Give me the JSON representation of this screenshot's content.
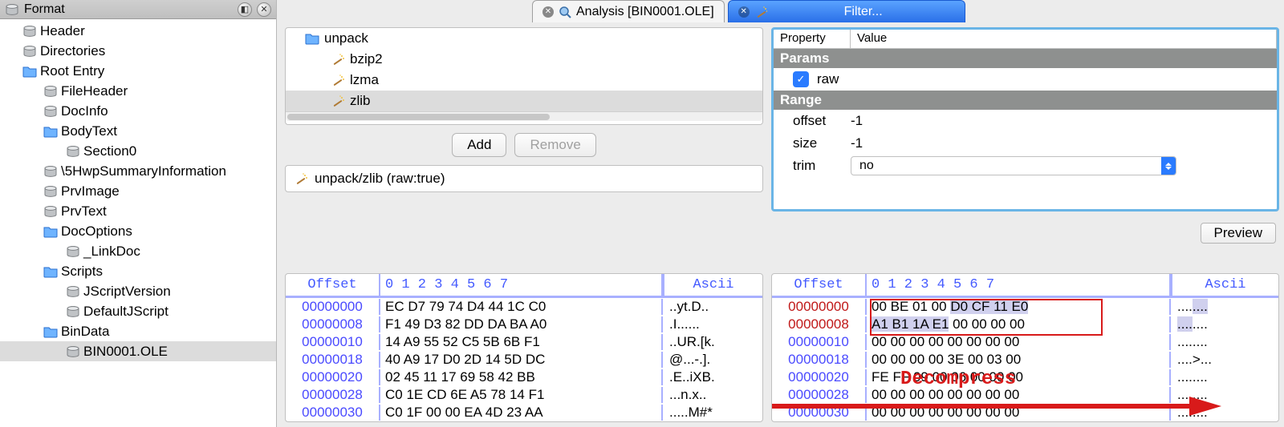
{
  "sidebar": {
    "title": "Format",
    "items": [
      {
        "label": "Header",
        "icon": "db",
        "indent": 0
      },
      {
        "label": "Directories",
        "icon": "db",
        "indent": 0
      },
      {
        "label": "Root Entry",
        "icon": "folder",
        "indent": 0
      },
      {
        "label": "FileHeader",
        "icon": "db",
        "indent": 1
      },
      {
        "label": "DocInfo",
        "icon": "db",
        "indent": 1
      },
      {
        "label": "BodyText",
        "icon": "folder",
        "indent": 1
      },
      {
        "label": "Section0",
        "icon": "db",
        "indent": 2
      },
      {
        "label": "\\5HwpSummaryInformation",
        "icon": "db",
        "indent": 1
      },
      {
        "label": "PrvImage",
        "icon": "db",
        "indent": 1
      },
      {
        "label": "PrvText",
        "icon": "db",
        "indent": 1
      },
      {
        "label": "DocOptions",
        "icon": "folder",
        "indent": 1
      },
      {
        "label": "_LinkDoc",
        "icon": "db",
        "indent": 2
      },
      {
        "label": "Scripts",
        "icon": "folder",
        "indent": 1
      },
      {
        "label": "JScriptVersion",
        "icon": "db",
        "indent": 2
      },
      {
        "label": "DefaultJScript",
        "icon": "db",
        "indent": 2
      },
      {
        "label": "BinData",
        "icon": "folder",
        "indent": 1
      },
      {
        "label": "BIN0001.OLE",
        "icon": "db",
        "indent": 2,
        "sel": true
      }
    ]
  },
  "tabs": {
    "analysis": "Analysis [BIN0001.OLE]",
    "filter": "Filter..."
  },
  "unpack": {
    "root": "unpack",
    "items": [
      "bzip2",
      "lzma",
      "zlib"
    ],
    "selected": "zlib"
  },
  "buttons": {
    "add": "Add",
    "remove": "Remove",
    "preview": "Preview"
  },
  "path": "unpack/zlib (raw:true)",
  "props": {
    "headers": {
      "property": "Property",
      "value": "Value"
    },
    "sections": {
      "params": "Params",
      "range": "Range"
    },
    "raw_label": "raw",
    "offset_k": "offset",
    "offset_v": "-1",
    "size_k": "size",
    "size_v": "-1",
    "trim_k": "trim",
    "trim_v": "no"
  },
  "hexheaders": {
    "offset": "Offset",
    "cols": "0  1  2  3  4  5  6  7",
    "ascii": "Ascii"
  },
  "hex_left": [
    {
      "off": "00000000",
      "hx": "EC D7 79 74 D4 44 1C C0",
      "asc": "..yt.D.."
    },
    {
      "off": "00000008",
      "hx": "F1 49 D3 82 DD DA BA A0",
      "asc": ".I......"
    },
    {
      "off": "00000010",
      "hx": "14 A9 55 52 C5 5B 6B F1",
      "asc": "..UR.[k."
    },
    {
      "off": "00000018",
      "hx": "40 A9 17 D0 2D 14 5D DC",
      "asc": "@...-.]."
    },
    {
      "off": "00000020",
      "hx": "02 45 11 17 69 58 42 BB",
      "asc": ".E..iXB."
    },
    {
      "off": "00000028",
      "hx": "C0 1E CD 6E A5 78 14 F1",
      "asc": "...n.x.."
    },
    {
      "off": "00000030",
      "hx": "C0 1F 00 00 EA 4D 23 AA",
      "asc": ".....M#*"
    }
  ],
  "hex_right": [
    {
      "off": "00000000",
      "red": true,
      "hx": "00 BE 01 00 D0 CF 11 E0",
      "asc": "........"
    },
    {
      "off": "00000008",
      "red": true,
      "hx": "A1 B1 1A E1 00 00 00 00",
      "asc": "........"
    },
    {
      "off": "00000010",
      "hx": "00 00 00 00 00 00 00 00",
      "asc": "........"
    },
    {
      "off": "00000018",
      "hx": "00 00 00 00 3E 00 03 00",
      "asc": "....>..."
    },
    {
      "off": "00000020",
      "hx": "FE FF 09 00 06 00 00 00",
      "asc": "........"
    },
    {
      "off": "00000028",
      "hx": "00 00 00 00 00 00 00 00",
      "asc": "........"
    },
    {
      "off": "00000030",
      "hx": "00 00 00 00 00 00 00 00",
      "asc": "........"
    }
  ],
  "annot": "Decompress"
}
